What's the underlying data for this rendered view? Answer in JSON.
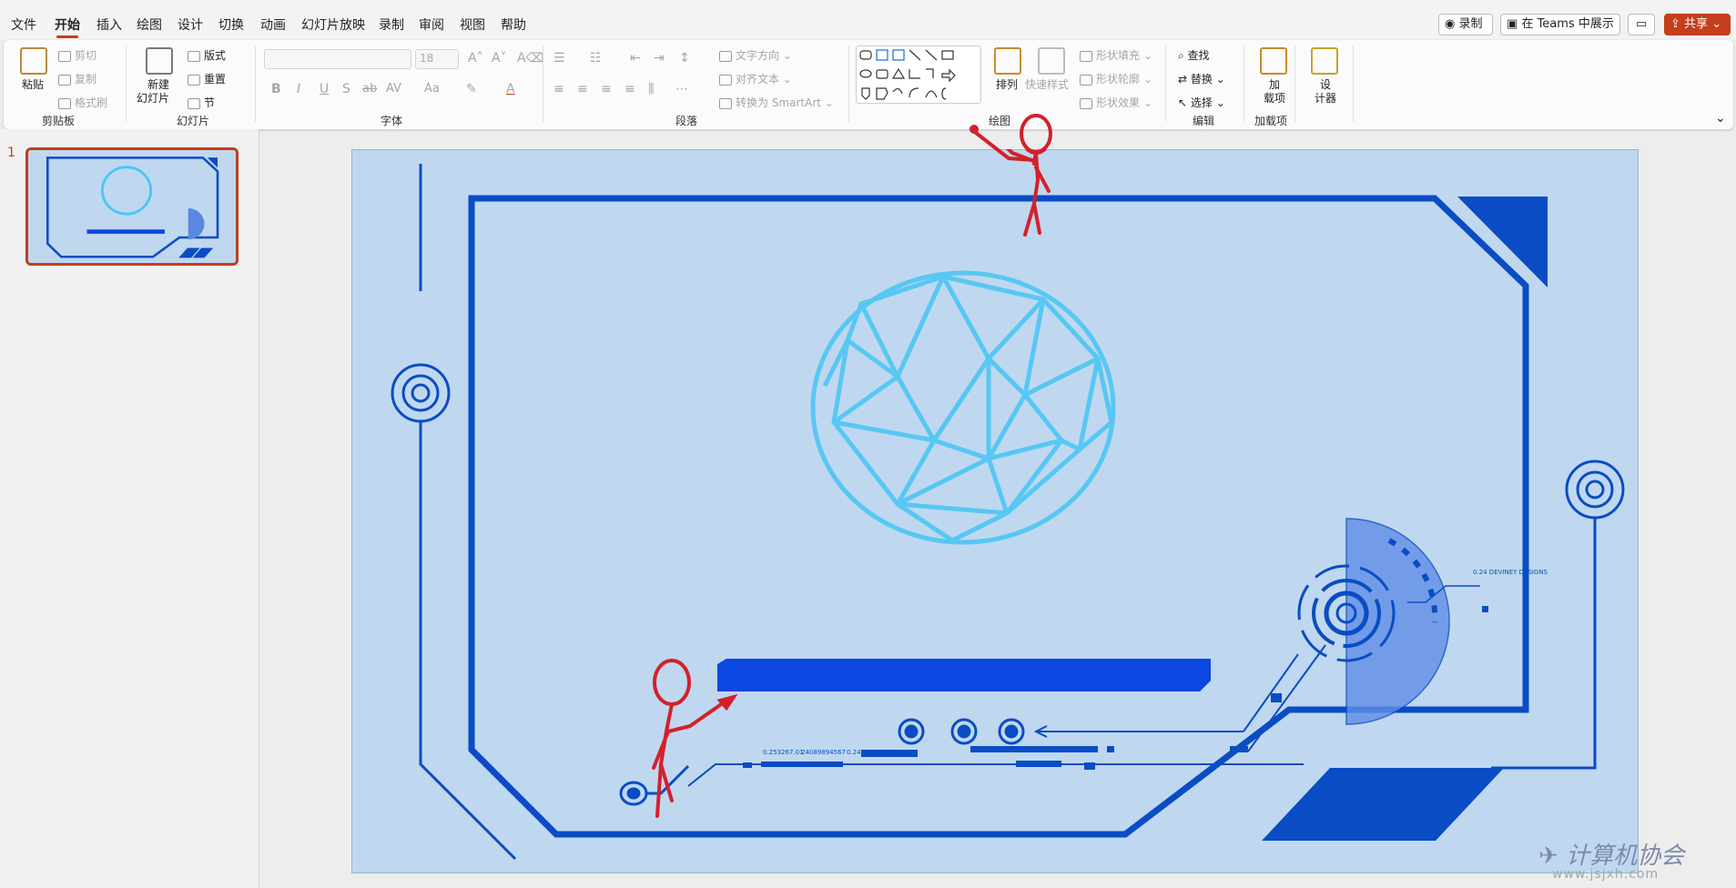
{
  "menu": {
    "tabs": [
      "文件",
      "开始",
      "插入",
      "绘图",
      "设计",
      "切换",
      "动画",
      "幻灯片放映",
      "录制",
      "审阅",
      "视图",
      "帮助"
    ],
    "active_tab": "开始",
    "record_label": "录制",
    "teams_label": "在 Teams 中展示",
    "share_label": "共享"
  },
  "ribbon": {
    "clipboard": {
      "paste": "粘贴",
      "cut": "剪切",
      "copy": "复制",
      "format_painter": "格式刷",
      "group": "剪贴板"
    },
    "slides": {
      "new_slide_line1": "新建",
      "new_slide_line2": "幻灯片",
      "layout": "版式",
      "reset": "重置",
      "section": "节",
      "group": "幻灯片"
    },
    "font": {
      "font_name": "",
      "font_size": "18",
      "bold": "B",
      "italic": "I",
      "underline": "U",
      "shadow": "S",
      "strike": "ab",
      "spacing": "AV",
      "case": "Aa",
      "color": "A",
      "group": "字体"
    },
    "paragraph": {
      "text_direction": "文字方向",
      "align_text": "对齐文本",
      "smartart": "转换为 SmartArt",
      "group": "段落"
    },
    "drawing": {
      "arrange": "排列",
      "quick_styles": "快速样式",
      "shape_fill": "形状填充",
      "shape_outline": "形状轮廓",
      "shape_effects": "形状效果",
      "group": "绘图"
    },
    "editing": {
      "find": "查找",
      "replace": "替换",
      "select": "选择",
      "group": "编辑"
    },
    "addins": {
      "addin_line1": "加",
      "addin_line2": "载项",
      "group": "加载项"
    },
    "designer": {
      "line1": "设",
      "line2": "计器"
    }
  },
  "thumbnails": {
    "number": "1"
  },
  "slide": {
    "label_top_right": "0.24 DEVINEY DESIGNS",
    "data_text_1": "0.253267.01",
    "data_text_2": "24089894567",
    "data_text_3": "0.24"
  },
  "watermark": {
    "title": "计算机协会",
    "url": "www.jsjxh.com"
  },
  "colors": {
    "accent": "#c43e1c",
    "slide_bg": "#bfd8ef",
    "frame": "#0a4cc4",
    "bar": "#0b47e0",
    "stick_figure": "#d4202b",
    "sphere": "#4cc6f5"
  }
}
